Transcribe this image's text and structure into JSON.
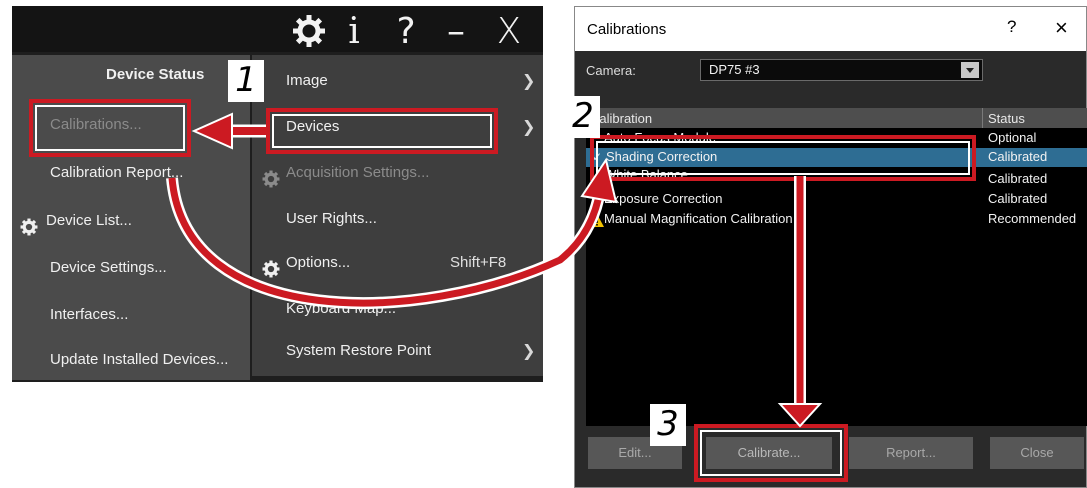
{
  "app_menu": {
    "left_header": "Device Status",
    "left_items": [
      {
        "label": "Calibrations...",
        "disabled": true
      },
      {
        "label": "Calibration Report..."
      },
      {
        "label": "Device List...",
        "icon": "gear-icon"
      },
      {
        "label": "Device Settings..."
      },
      {
        "label": "Interfaces..."
      },
      {
        "label": "Update Installed Devices..."
      }
    ],
    "right_items": [
      {
        "label": "Image",
        "submenu": true
      },
      {
        "label": "Devices",
        "submenu": true
      },
      {
        "label": "Acquisition Settings...",
        "disabled": true,
        "icon": "gear-icon"
      },
      {
        "label": "User Rights..."
      },
      {
        "label": "Options...",
        "icon": "gear-icon",
        "shortcut": "Shift+F8"
      },
      {
        "label": "Keyboard Map..."
      },
      {
        "label": "System Restore Point",
        "submenu": true
      }
    ],
    "title_bar_icons": [
      "gear-icon",
      "info-icon",
      "help-icon",
      "minimize-icon",
      "close-icon"
    ],
    "title_bar_glyphs": {
      "info": "i",
      "help": "?",
      "minimize": "–",
      "close": "X"
    }
  },
  "dialog": {
    "title": "Calibrations",
    "help_glyph": "?",
    "close_glyph": "×",
    "camera_label": "Camera:",
    "camera_value": "DP75 #3",
    "columns": [
      "Calibration",
      "Status"
    ],
    "rows": [
      {
        "name": "Auto Focus Module",
        "status": "Optional"
      },
      {
        "name": "Shading Correction",
        "status": "Calibrated",
        "selected": true
      },
      {
        "name": "White Balance",
        "status": "Calibrated"
      },
      {
        "name": "Exposure Correction",
        "status": "Calibrated"
      },
      {
        "name": "Manual Magnification Calibration",
        "status": "Recommended",
        "icon": "warning-icon"
      }
    ],
    "buttons": {
      "edit": "Edit...",
      "calibrate": "Calibrate...",
      "report": "Report...",
      "close": "Close"
    }
  },
  "steps": [
    "1",
    "2",
    "3"
  ],
  "colors": {
    "annotation_red": "#cc1a22",
    "selection_blue": "#2e6d93",
    "menu_bg": "#4b4b4b"
  }
}
